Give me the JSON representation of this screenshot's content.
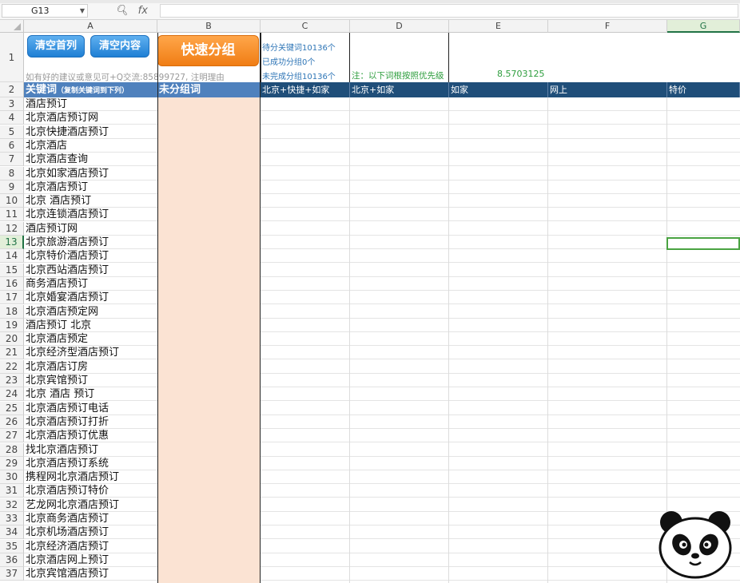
{
  "formula_bar": {
    "cell_ref": "G13",
    "zoom_icon": "magnifier-icon",
    "fx_label": "fx",
    "formula": ""
  },
  "columns": [
    "A",
    "B",
    "C",
    "D",
    "E",
    "F",
    "G"
  ],
  "active_column": "G",
  "active_row": "13",
  "row1": {
    "clear_first_col_label": "清空首列",
    "clear_content_label": "清空内容",
    "quick_group_label": "快速分组",
    "feedback_note": "如有好的建议或意见可+Q交流:85899727, 注明理由",
    "stat_pending": "待分关键词10136个",
    "stat_done": "已成功分组0个",
    "stat_undone": "未完成分组10136个",
    "green_note": "注：以下词根按照优先级",
    "green_value": "8.5703125"
  },
  "row2": {
    "keyword_header_main": "关键词",
    "keyword_header_sub": "（复制关键词到下列）",
    "ungrouped_header": "未分组词",
    "roots": [
      "北京+快捷+如家",
      "北京+如家",
      "如家",
      "网上",
      "特价"
    ]
  },
  "row_numbers": [
    "3",
    "4",
    "5",
    "6",
    "7",
    "8",
    "9",
    "10",
    "11",
    "12",
    "13",
    "14",
    "15",
    "16",
    "17",
    "18",
    "19",
    "20",
    "21",
    "22",
    "23",
    "24",
    "25",
    "26",
    "27",
    "28",
    "29",
    "30",
    "31",
    "32",
    "33",
    "34",
    "35",
    "36",
    "37"
  ],
  "keywords": [
    "酒店预订",
    "北京酒店预订网",
    "北京快捷酒店预订",
    "北京酒店",
    "北京酒店查询",
    "北京如家酒店预订",
    "北京酒店预订",
    "北京 酒店预订",
    "北京连锁酒店预订",
    "酒店预订网",
    "北京旅游酒店预订",
    "北京特价酒店预订",
    "北京西站酒店预订",
    "商务酒店预订",
    "北京婚宴酒店预订",
    "北京酒店预定网",
    "酒店预订 北京",
    "北京酒店预定",
    "北京经济型酒店预订",
    "北京酒店订房",
    "北京宾馆预订",
    "北京 酒店 预订",
    "北京酒店预订电话",
    "北京酒店预订打折",
    "北京酒店预订优惠",
    "找北京酒店预订",
    "北京酒店预订系统",
    "携程网北京酒店预订",
    "北京酒店预订特价",
    "艺龙网北京酒店预订",
    "北京商务酒店预订",
    "北京机场酒店预订",
    "北京经济酒店预订",
    "北京酒店网上预订",
    "北京宾馆酒店预订"
  ],
  "watermark_icon": "panda-logo-icon"
}
